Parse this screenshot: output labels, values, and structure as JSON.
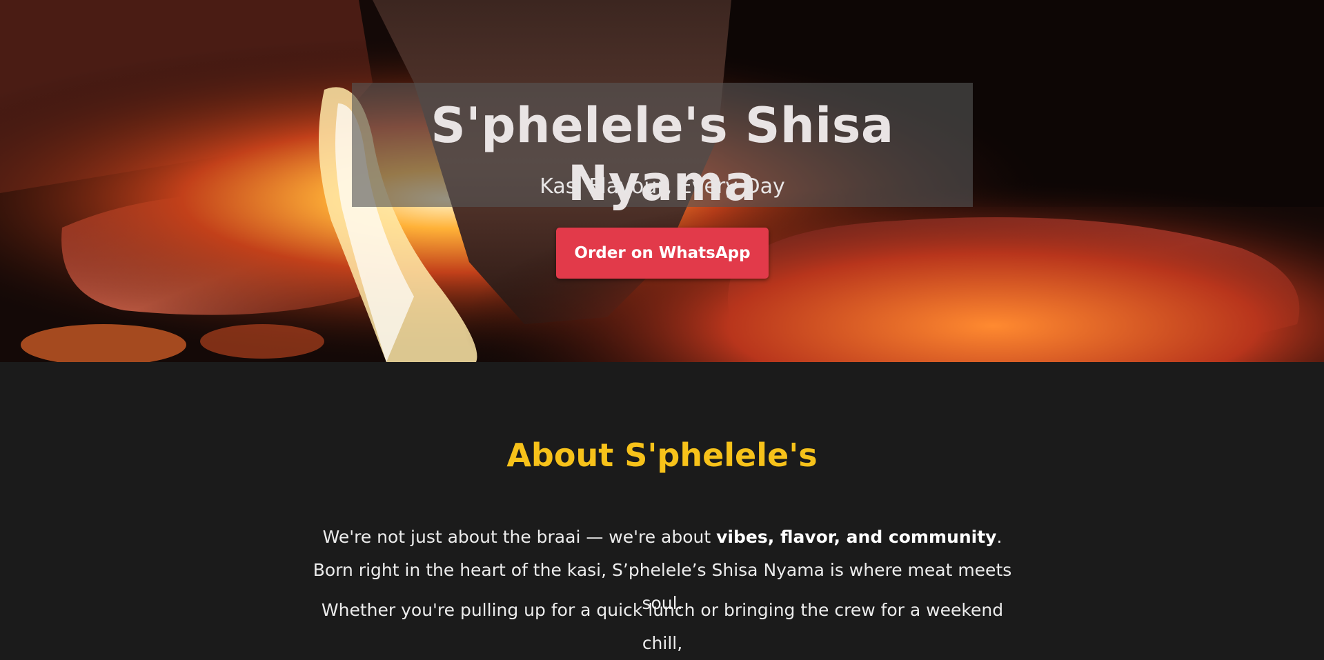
{
  "hero": {
    "title": "S'phelele's Shisa Nyama",
    "tagline": "Kasi Flavour, Every Day",
    "cta_label": "Order on WhatsApp",
    "background": "grilled-meat-fire-photo"
  },
  "about": {
    "heading": "About S'phelele's",
    "p1_before": "We're not just about the braai — we're about ",
    "p1_bold": "vibes, flavor, and community",
    "p1_after": ". Born right in the heart of the kasi, S’phelele’s Shisa Nyama is where meat meets soul.",
    "p2": "Whether you're pulling up for a quick lunch or bringing the crew for a weekend chill,"
  },
  "colors": {
    "accent_heading": "#f7c21a",
    "cta_background": "#e23a4a",
    "page_background": "#1b1b1b"
  }
}
